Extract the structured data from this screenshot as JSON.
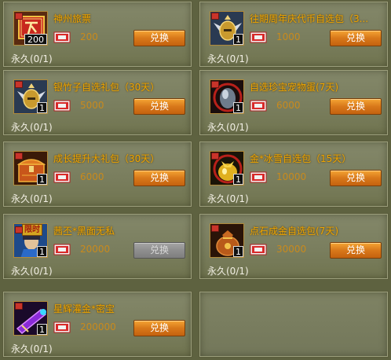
{
  "items": [
    {
      "name": "神州旅票",
      "price": "200",
      "quantity": "200",
      "status": "永久(0/1)",
      "button": "兑换",
      "button_enabled": true,
      "limited": "",
      "icon": "ticket-icon"
    },
    {
      "name": "往期周年庆代币自选包（3...",
      "price": "1000",
      "quantity": "1",
      "status": "永久(0/1)",
      "button": "兑换",
      "button_enabled": true,
      "limited": "",
      "icon": "winged-helmet-icon"
    },
    {
      "name": "银竹子自选礼包（30天）",
      "price": "5000",
      "quantity": "1",
      "status": "永久(0/1)",
      "button": "兑换",
      "button_enabled": true,
      "limited": "",
      "icon": "winged-helmet-icon"
    },
    {
      "name": "自选珍宝宠物蛋(7天)",
      "price": "6000",
      "quantity": "1",
      "status": "永久(0/1)",
      "button": "兑换",
      "button_enabled": true,
      "limited": "",
      "icon": "pet-egg-icon"
    },
    {
      "name": "成长提升大礼包（30天）",
      "price": "6000",
      "quantity": "1",
      "status": "永久(0/1)",
      "button": "兑换",
      "button_enabled": true,
      "limited": "",
      "icon": "treasure-chest-icon"
    },
    {
      "name": "金*冰雪自选包（15天）",
      "price": "10000",
      "quantity": "1",
      "status": "永久(0/1)",
      "button": "兑换",
      "button_enabled": true,
      "limited": "",
      "icon": "gold-bag-icon"
    },
    {
      "name": "茜丕*黑面无私",
      "price": "20000",
      "quantity": "1",
      "status": "永久(0/1)",
      "button": "兑换",
      "button_enabled": false,
      "limited": "限时",
      "icon": "character-portrait-icon"
    },
    {
      "name": "点石成金自选包(7天)",
      "price": "30000",
      "quantity": "1",
      "status": "永久(0/1)",
      "button": "兑换",
      "button_enabled": true,
      "limited": "",
      "icon": "money-pouch-icon"
    },
    {
      "name": "星辉灌金*密宝",
      "price": "200000",
      "quantity": "1",
      "status": "永久(0/1)",
      "button": "兑换",
      "button_enabled": true,
      "limited": "",
      "icon": "purple-cannon-icon"
    }
  ]
}
